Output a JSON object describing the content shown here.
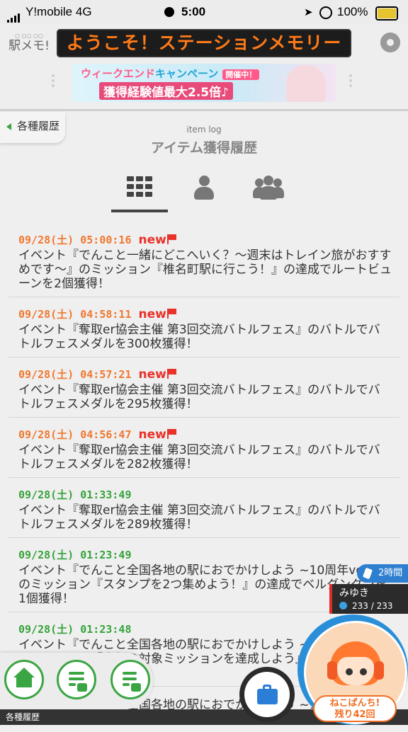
{
  "status": {
    "carrier": "Y!mobile   4G",
    "time": "5:00",
    "battery": "100%"
  },
  "header": {
    "logo": "駅メモ!",
    "marquee": "ようこそ！ステーションメモリー",
    "banner": {
      "line1a": "ウィークエンド",
      "line1b": "キャンペーン",
      "badge": "開催中！",
      "line2": "獲得経験値最大2.5倍♪"
    }
  },
  "page": {
    "back_label": "各種履歴",
    "subtitle_en": "item log",
    "title": "アイテム獲得履歴",
    "tabs": [
      {
        "icon": "grid-icon",
        "active": true
      },
      {
        "icon": "person-icon",
        "active": false
      },
      {
        "icon": "group-icon",
        "active": false
      }
    ]
  },
  "entries": [
    {
      "date": "09/28(土) 05:00:16",
      "new": "new",
      "text": "イベント『でんこと一緒にどこへいく？～週末はトレイン旅がおすすめです～』のミッション『椎名町駅に行こう！』の達成でルートビューンを2個獲得！"
    },
    {
      "date": "09/28(土) 04:58:11",
      "new": "new",
      "text": "イベント『奪取er協会主催 第3回交流バトルフェス』のバトルでバトルフェスメダルを300枚獲得！"
    },
    {
      "date": "09/28(土) 04:57:21",
      "new": "new",
      "text": "イベント『奪取er協会主催 第3回交流バトルフェス』のバトルでバトルフェスメダルを295枚獲得！"
    },
    {
      "date": "09/28(土) 04:56:47",
      "new": "new",
      "text": "イベント『奪取er協会主催 第3回交流バトルフェス』のバトルでバトルフェスメダルを282枚獲得！"
    },
    {
      "date": "09/28(土) 01:33:49",
      "new": "",
      "text": "イベント『奪取er協会主催 第3回交流バトルフェス』のバトルでバトルフェスメダルを289枚獲得！"
    },
    {
      "date": "09/28(土) 01:23:49",
      "new": "",
      "text": "イベント『でんこと全国各地の駅におでかけしよう ~10周年ver.~』のミッション『スタンプを2つ集めよう！』の達成でベルグングンを1個獲得！"
    },
    {
      "date": "09/28(土) 01:23:48",
      "new": "",
      "text": "イベント『でんこと全国各地の駅におでかけしよう ~10周年ver.~』のミッション『中部の対象ミッションを達成しよう』の達成でスタンプを1個獲得！"
    },
    {
      "date": "",
      "new": "",
      "text": "イベント『でんこと全国各地の駅におでかけしよう ~10周年ver.~』のミッション『本宿[愛知]駅に"
    }
  ],
  "widgets": {
    "time_badge": "2時間",
    "user_name": "みゆき",
    "user_hp": "233 / 233",
    "neko_line1": "ねこぱんち!",
    "neko_line2": "残り42回"
  },
  "bottom_label": "各種履歴",
  "colors": {
    "date_new": "#f0772f",
    "date_old": "#35a33b",
    "new_tag": "#e8322a",
    "accent": "#3aa543"
  }
}
